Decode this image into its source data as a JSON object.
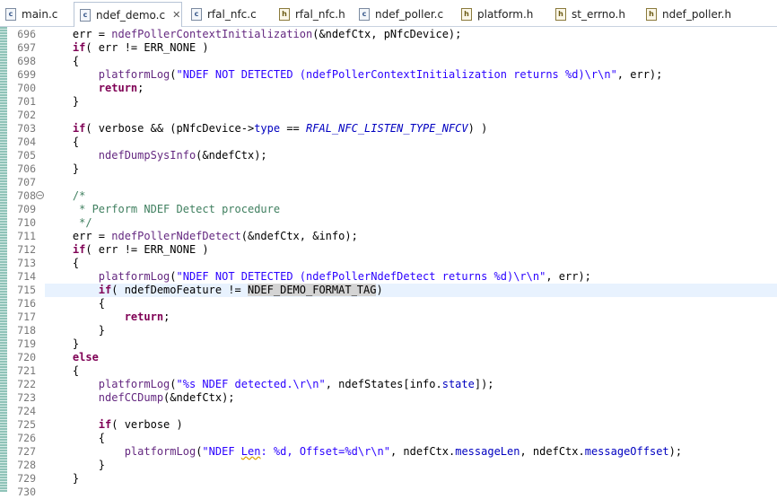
{
  "tabs": [
    {
      "label": "main.c",
      "type": "c",
      "active": false
    },
    {
      "label": "ndef_demo.c",
      "type": "c",
      "active": true
    },
    {
      "label": "rfal_nfc.c",
      "type": "c",
      "active": false
    },
    {
      "label": "rfal_nfc.h",
      "type": "h",
      "active": false
    },
    {
      "label": "ndef_poller.c",
      "type": "c",
      "active": false
    },
    {
      "label": "platform.h",
      "type": "h",
      "active": false
    },
    {
      "label": "st_errno.h",
      "type": "h",
      "active": false
    },
    {
      "label": "ndef_poller.h",
      "type": "h",
      "active": false
    }
  ],
  "close_glyph": "✕",
  "fold_glyph": "⊖",
  "line_numbers": [
    "696",
    "697",
    "698",
    "699",
    "700",
    "701",
    "702",
    "703",
    "704",
    "705",
    "706",
    "707",
    "708",
    "709",
    "710",
    "711",
    "712",
    "713",
    "714",
    "715",
    "716",
    "717",
    "718",
    "719",
    "720",
    "721",
    "722",
    "723",
    "724",
    "725",
    "726",
    "727",
    "728",
    "729",
    "730"
  ],
  "code_lines": [
    [
      [
        "t",
        "    err = "
      ],
      [
        "fn",
        "ndefPollerContextInitialization"
      ],
      [
        "t",
        "(&ndefCtx, pNfcDevice);"
      ]
    ],
    [
      [
        "t",
        "    "
      ],
      [
        "kw",
        "if"
      ],
      [
        "t",
        "( err != ERR_NONE )"
      ]
    ],
    [
      [
        "t",
        "    {"
      ]
    ],
    [
      [
        "t",
        "        "
      ],
      [
        "fn",
        "platformLog"
      ],
      [
        "t",
        "("
      ],
      [
        "str",
        "\"NDEF NOT DETECTED (ndefPollerContextInitialization returns %d)\\r\\n\""
      ],
      [
        "t",
        ", err);"
      ]
    ],
    [
      [
        "t",
        "        "
      ],
      [
        "kw",
        "return"
      ],
      [
        "t",
        ";"
      ]
    ],
    [
      [
        "t",
        "    }"
      ]
    ],
    [],
    [
      [
        "t",
        "    "
      ],
      [
        "kw",
        "if"
      ],
      [
        "t",
        "( verbose && (pNfcDevice->"
      ],
      [
        "fld",
        "type"
      ],
      [
        "t",
        " == "
      ],
      [
        "mac",
        "RFAL_NFC_LISTEN_TYPE_NFCV"
      ],
      [
        "t",
        ") )"
      ]
    ],
    [
      [
        "t",
        "    {"
      ]
    ],
    [
      [
        "t",
        "        "
      ],
      [
        "fn",
        "ndefDumpSysInfo"
      ],
      [
        "t",
        "(&ndefCtx);"
      ]
    ],
    [
      [
        "t",
        "    }"
      ]
    ],
    [],
    [
      [
        "cm",
        "    /*"
      ]
    ],
    [
      [
        "cm",
        "     * Perform NDEF Detect procedure"
      ]
    ],
    [
      [
        "cm",
        "     */"
      ]
    ],
    [
      [
        "t",
        "    err = "
      ],
      [
        "fn",
        "ndefPollerNdefDetect"
      ],
      [
        "t",
        "(&ndefCtx, &info);"
      ]
    ],
    [
      [
        "t",
        "    "
      ],
      [
        "kw",
        "if"
      ],
      [
        "t",
        "( err != ERR_NONE )"
      ]
    ],
    [
      [
        "t",
        "    {"
      ]
    ],
    [
      [
        "t",
        "        "
      ],
      [
        "fn",
        "platformLog"
      ],
      [
        "t",
        "("
      ],
      [
        "str",
        "\"NDEF NOT DETECTED (ndefPollerNdefDetect returns %d)\\r\\n\""
      ],
      [
        "t",
        ", err);"
      ]
    ],
    [
      [
        "t",
        "        "
      ],
      [
        "kw",
        "if"
      ],
      [
        "t",
        "( ndefDemoFeature != "
      ],
      [
        "sel",
        "NDEF_DEMO_FORMAT_"
      ],
      [
        "caret",
        ""
      ],
      [
        "sel",
        "TAG"
      ],
      [
        "t",
        ")"
      ]
    ],
    [
      [
        "t",
        "        {"
      ]
    ],
    [
      [
        "t",
        "            "
      ],
      [
        "kw",
        "return"
      ],
      [
        "t",
        ";"
      ]
    ],
    [
      [
        "t",
        "        }"
      ]
    ],
    [
      [
        "t",
        "    }"
      ]
    ],
    [
      [
        "t",
        "    "
      ],
      [
        "kw",
        "else"
      ]
    ],
    [
      [
        "t",
        "    {"
      ]
    ],
    [
      [
        "t",
        "        "
      ],
      [
        "fn",
        "platformLog"
      ],
      [
        "t",
        "("
      ],
      [
        "str",
        "\"%s NDEF detected.\\r\\n\""
      ],
      [
        "t",
        ", ndefStates[info."
      ],
      [
        "fld",
        "state"
      ],
      [
        "t",
        "]);"
      ]
    ],
    [
      [
        "t",
        "        "
      ],
      [
        "fn",
        "ndefCCDump"
      ],
      [
        "t",
        "(&ndefCtx);"
      ]
    ],
    [],
    [
      [
        "t",
        "        "
      ],
      [
        "kw",
        "if"
      ],
      [
        "t",
        "( verbose )"
      ]
    ],
    [
      [
        "t",
        "        {"
      ]
    ],
    [
      [
        "t",
        "            "
      ],
      [
        "fn",
        "platformLog"
      ],
      [
        "t",
        "("
      ],
      [
        "str",
        "\"NDEF "
      ],
      [
        "squigstr",
        "Len"
      ],
      [
        "str",
        ": %d, Offset=%d\\r\\n\""
      ],
      [
        "t",
        ", ndefCtx."
      ],
      [
        "fld",
        "messageLen"
      ],
      [
        "t",
        ", ndefCtx."
      ],
      [
        "fld",
        "messageOffset"
      ],
      [
        "t",
        ");"
      ]
    ],
    [
      [
        "t",
        "        }"
      ]
    ],
    [
      [
        "t",
        "    }"
      ]
    ],
    []
  ],
  "highlight_line_index": 19,
  "fold_line_index": 12
}
